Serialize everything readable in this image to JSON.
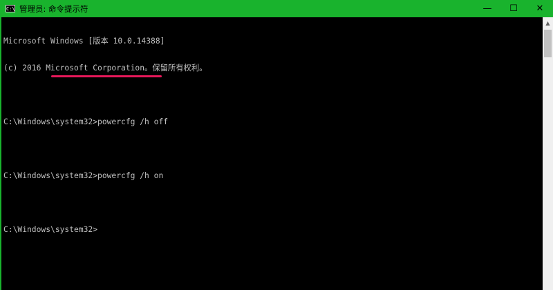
{
  "window": {
    "title": "管理员: 命令提示符",
    "icon_text": "C:\\",
    "caption": {
      "minimize": "—",
      "maximize": "☐",
      "close": "✕"
    }
  },
  "console": {
    "lines": [
      "Microsoft Windows [版本 10.0.14388]",
      "(c) 2016 Microsoft Corporation。保留所有权利。",
      "",
      "C:\\Windows\\system32>powercfg /h off",
      "",
      "C:\\Windows\\system32>powercfg /h on",
      "",
      "C:\\Windows\\system32>"
    ]
  },
  "colors": {
    "titlebar": "#19b32d",
    "console_bg": "#000000",
    "console_text": "#c0c0c0",
    "annotation": "#e8185a"
  },
  "icons": {
    "app": "cmd-icon",
    "scroll_up": "chevron-up-icon"
  }
}
